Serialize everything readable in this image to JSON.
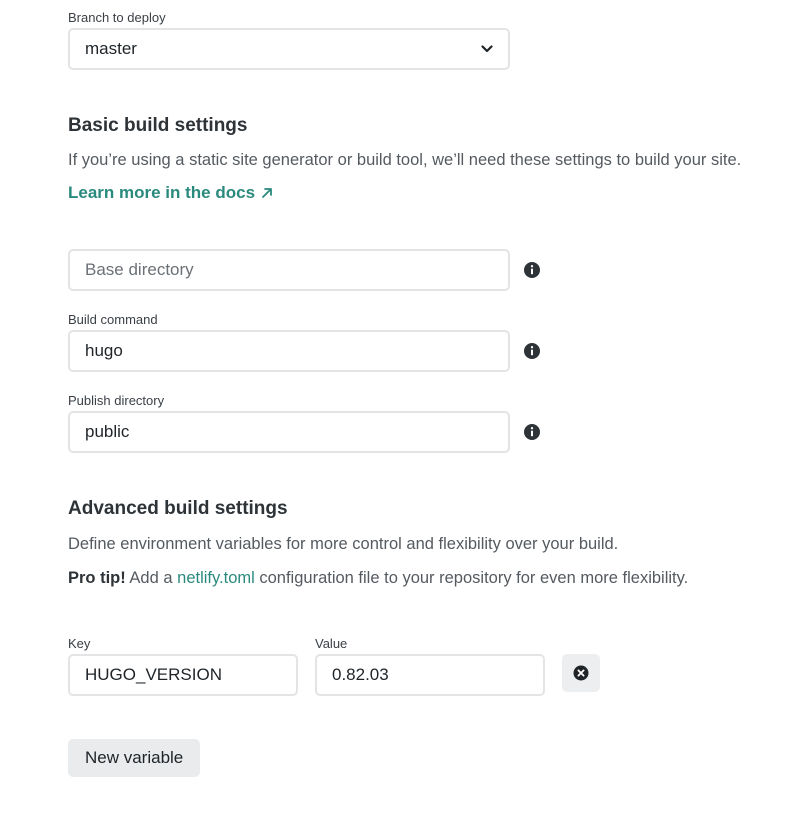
{
  "branch": {
    "label": "Branch to deploy",
    "selected": "master"
  },
  "basic": {
    "heading": "Basic build settings",
    "description": "If you’re using a static site generator or build tool, we’ll need these settings to build your site.",
    "docs_link": "Learn more in the docs",
    "docs_link_icon": "arrow-up-right-icon",
    "base_directory": {
      "placeholder": "Base directory",
      "value": ""
    },
    "build_command": {
      "label": "Build command",
      "value": "hugo"
    },
    "publish_directory": {
      "label": "Publish directory",
      "value": "public"
    }
  },
  "advanced": {
    "heading": "Advanced build settings",
    "description": "Define environment variables for more control and flexibility over your build.",
    "pro_tip_label": "Pro tip!",
    "pro_tip_before": " Add a ",
    "pro_tip_link": "netlify.toml",
    "pro_tip_after": " configuration file to your repository for even more flexibility.",
    "key_label": "Key",
    "value_label": "Value",
    "variables": [
      {
        "key": "HUGO_VERSION",
        "value": "0.82.03"
      }
    ],
    "new_variable_button": "New variable"
  },
  "colors": {
    "accent": "#2b8a7e",
    "heading": "#2e3338",
    "body": "#555a60",
    "border": "#e2e4e6",
    "button_bg": "#e9ebed"
  }
}
